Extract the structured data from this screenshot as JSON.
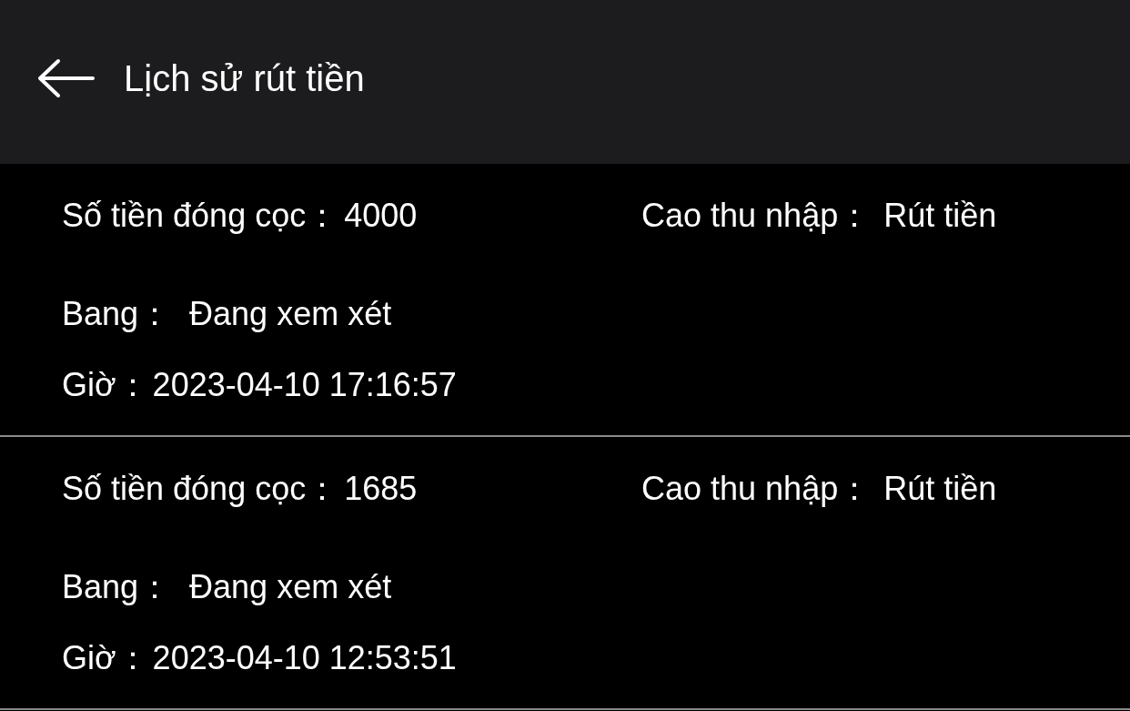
{
  "header": {
    "title": "Lịch sử rút tiền"
  },
  "records": [
    {
      "amount_label": "Số tiền đóng cọc：",
      "amount": "4000",
      "income_label": "Cao thu nhập：",
      "income": "Rút tiền",
      "status_label": "Bang：",
      "status": "Đang xem xét",
      "time_label": "Giờ：",
      "time": "2023-04-10 17:16:57"
    },
    {
      "amount_label": "Số tiền đóng cọc：",
      "amount": "1685",
      "income_label": "Cao thu nhập：",
      "income": "Rút tiền",
      "status_label": "Bang：",
      "status": "Đang xem xét",
      "time_label": "Giờ：",
      "time": "2023-04-10 12:53:51"
    }
  ]
}
